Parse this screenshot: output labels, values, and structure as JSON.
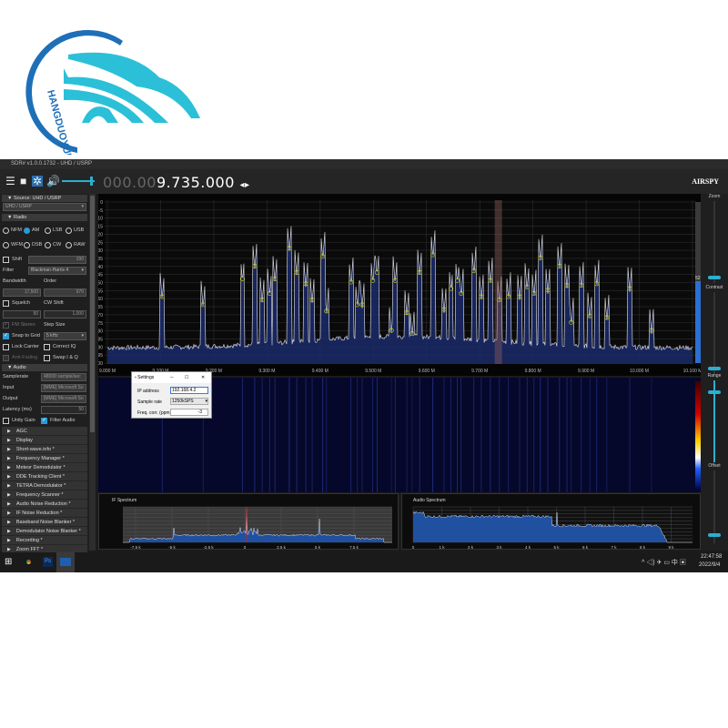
{
  "logo": {
    "text": "HANGDUOYUN"
  },
  "window": {
    "title": "SDR# v1.0.0.1732 - UHD / USRP"
  },
  "toolbar": {
    "freq_dim": "000.00",
    "freq_main": "9.735.000",
    "brand": "AIRSPY"
  },
  "left": {
    "source_header": "Source: UHD / USRP",
    "source_value": "UHD / USRP",
    "radio_header": "Radio",
    "modes": [
      {
        "label": "NFM",
        "on": false
      },
      {
        "label": "AM",
        "on": true
      },
      {
        "label": "LSB",
        "on": false
      },
      {
        "label": "USB",
        "on": false
      },
      {
        "label": "WFM",
        "on": false
      },
      {
        "label": "DSB",
        "on": false
      },
      {
        "label": "CW",
        "on": false
      },
      {
        "label": "RAW",
        "on": false
      }
    ],
    "shift_label": "Shift",
    "shift_value": "190",
    "filter_label": "Filter",
    "filter_value": "Blackman-Harris 4",
    "bandwidth_label": "Bandwidth",
    "order_label": "Order",
    "bandwidth_value": "17,500",
    "order_value": "970",
    "squelch_label": "Squelch",
    "cwshift_label": "CW Shift",
    "squelch_value": "50",
    "cwshift_value": "1,000",
    "fmstereo_label": "FM Stereo",
    "stepsize_label": "Step Size",
    "snap_label": "Snap to Grid",
    "step_value": "5 kHz",
    "lockcarrier_label": "Lock Carrier",
    "correctiq_label": "Correct IQ",
    "antifading_label": "Anti-Fading",
    "swapiq_label": "Swap I & Q",
    "audio_header": "Audio",
    "samplerate_label": "Samplerate",
    "samplerate_value": "48000 sample/sec",
    "input_label": "Input",
    "input_value": "[MME] Microsoft So",
    "output_label": "Output",
    "output_value": "[MME] Microsoft So",
    "latency_label": "Latency (ms)",
    "latency_value": "50",
    "unity_label": "Unity Gain",
    "filteraudio_label": "Filter Audio",
    "plugins": [
      "AGC",
      "Display",
      "Short-wave.info *",
      "Frequency Manager *",
      "Meteor Demodulator *",
      "DDE Tracking Client *",
      "TETRA Demodulator *",
      "Frequency Scanner *",
      "Audio Noise Reduction *",
      "IF Noise Reduction *",
      "Baseband Noise Blanker *",
      "Demodulator Noise Blanker *",
      "Recording *",
      "Zoom FFT *"
    ]
  },
  "settings": {
    "title": "Settings",
    "ip_label": "IP address",
    "ip_value": "192.168.4.2",
    "rate_label": "Sample rate",
    "rate_value": "1250kSPS",
    "corr_label": "Freq. corr. (ppm)",
    "corr_value": "-3"
  },
  "spectrum": {
    "y_ticks": [
      "0",
      "-5",
      "-10",
      "-15",
      "-20",
      "-25",
      "-30",
      "-35",
      "-40",
      "-45",
      "-50",
      "-55",
      "-60",
      "-65",
      "-70",
      "-75",
      "-80",
      "-85",
      "-90",
      "-95",
      "-100"
    ],
    "x_ticks": [
      "9.000 M",
      "9.100 M",
      "9.200 M",
      "9.300 M",
      "9.400 M",
      "9.500 M",
      "9.600 M",
      "9.700 M",
      "9.800 M",
      "9.900 M",
      "10.000 M",
      "10.100 M"
    ],
    "tuned_mhz": 9.735,
    "peaks": [
      [
        9.103,
        -61
      ],
      [
        9.18,
        -66
      ],
      [
        9.254,
        -50
      ],
      [
        9.277,
        -42
      ],
      [
        9.291,
        -63
      ],
      [
        9.305,
        -59
      ],
      [
        9.315,
        -50
      ],
      [
        9.342,
        -31
      ],
      [
        9.356,
        -46
      ],
      [
        9.373,
        -53
      ],
      [
        9.385,
        -63
      ],
      [
        9.405,
        -36
      ],
      [
        9.412,
        -70
      ],
      [
        9.458,
        -52
      ],
      [
        9.47,
        -66
      ],
      [
        9.479,
        -66
      ],
      [
        9.499,
        -51
      ],
      [
        9.507,
        -46
      ],
      [
        9.534,
        -82
      ],
      [
        9.541,
        -51
      ],
      [
        9.563,
        -71
      ],
      [
        9.573,
        -84
      ],
      [
        9.587,
        -46
      ],
      [
        9.612,
        -35
      ],
      [
        9.633,
        -69
      ],
      [
        9.646,
        -56
      ],
      [
        9.658,
        -51
      ],
      [
        9.665,
        -59
      ],
      [
        9.689,
        -45
      ],
      [
        9.703,
        -61
      ],
      [
        9.72,
        -51
      ],
      [
        9.737,
        -63
      ],
      [
        9.754,
        -61
      ],
      [
        9.775,
        -61
      ],
      [
        9.789,
        -55
      ],
      [
        9.802,
        -59
      ],
      [
        9.814,
        -37
      ],
      [
        9.828,
        -57
      ],
      [
        9.85,
        -42
      ],
      [
        9.864,
        -54
      ],
      [
        9.872,
        -77
      ],
      [
        9.891,
        -54
      ],
      [
        9.907,
        -73
      ],
      [
        9.92,
        -53
      ],
      [
        9.939,
        -74
      ],
      [
        9.982,
        -56
      ],
      [
        10.023,
        -82
      ]
    ],
    "level_value": "52"
  },
  "right": {
    "zoom": "Zoom",
    "contrast": "Contrast",
    "range": "Range",
    "offset": "Offset"
  },
  "if_spectrum": {
    "title": "IF Spectrum",
    "x_ticks": [
      "-7.5 k",
      "-5 k",
      "-2.5 k",
      "0",
      "2.5 k",
      "5 k",
      "7.5 k"
    ]
  },
  "audio_spectrum": {
    "title": "Audio Spectrum",
    "x_ticks": [
      "0",
      "1 k",
      "2 k",
      "3 k",
      "4 k",
      "5 k",
      "6 k",
      "7 k",
      "8 k",
      "9 k"
    ]
  },
  "taskbar": {
    "time": "22:47:58",
    "date": "2022/9/4",
    "ime": "中"
  },
  "colors": {
    "accent": "#2a9bd6",
    "peak_marker": "#e0e000",
    "spectrum_fill": "#1a2a6a"
  }
}
